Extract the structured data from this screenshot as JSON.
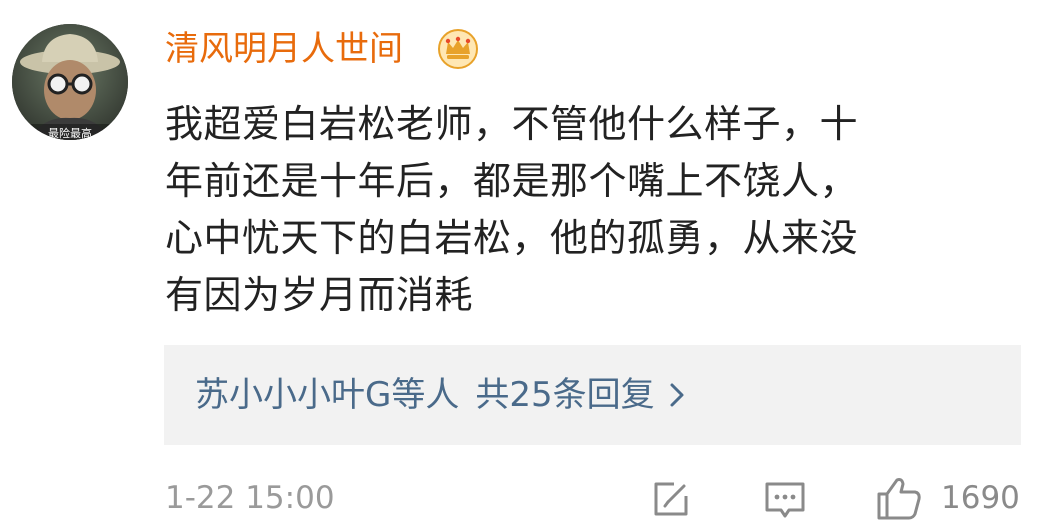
{
  "comment": {
    "username": "清风明月人世间",
    "text_lines": [
      "我超爱白岩松老师，不管他什么样子，十",
      "年前还是十年后，都是那个嘴上不饶人，",
      "心中忧天下的白岩松，他的孤勇，从来没",
      "有因为岁月而消耗"
    ],
    "avatar_caption": "最险最高",
    "replies": {
      "names": "苏小小小叶G等人",
      "count_label": "共25条回复"
    },
    "timestamp": "1-22 15:00",
    "likes": "1690"
  },
  "icons": {
    "badge": "crown-icon",
    "edit": "edit-icon",
    "comment": "comment-icon",
    "like": "thumbs-up-icon",
    "reply_arrow": "chevron-right-icon"
  },
  "colors": {
    "username": "#e86b0c",
    "text": "#222222",
    "reply_link": "#4a6a8a",
    "meta": "#9a9a9a",
    "reply_bg": "#f2f2f2"
  }
}
